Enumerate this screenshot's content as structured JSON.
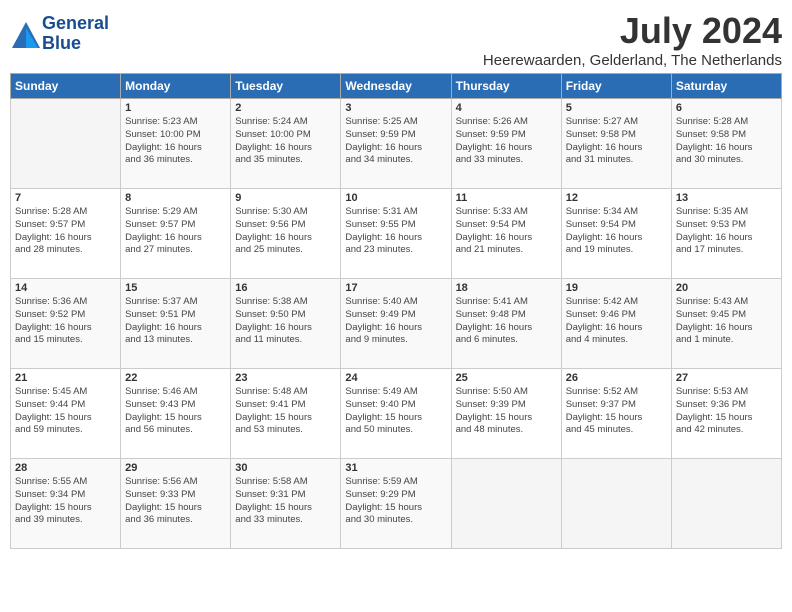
{
  "header": {
    "logo_line1": "General",
    "logo_line2": "Blue",
    "month": "July 2024",
    "location": "Heerewaarden, Gelderland, The Netherlands"
  },
  "days_of_week": [
    "Sunday",
    "Monday",
    "Tuesday",
    "Wednesday",
    "Thursday",
    "Friday",
    "Saturday"
  ],
  "weeks": [
    [
      {
        "num": "",
        "info": ""
      },
      {
        "num": "1",
        "info": "Sunrise: 5:23 AM\nSunset: 10:00 PM\nDaylight: 16 hours\nand 36 minutes."
      },
      {
        "num": "2",
        "info": "Sunrise: 5:24 AM\nSunset: 10:00 PM\nDaylight: 16 hours\nand 35 minutes."
      },
      {
        "num": "3",
        "info": "Sunrise: 5:25 AM\nSunset: 9:59 PM\nDaylight: 16 hours\nand 34 minutes."
      },
      {
        "num": "4",
        "info": "Sunrise: 5:26 AM\nSunset: 9:59 PM\nDaylight: 16 hours\nand 33 minutes."
      },
      {
        "num": "5",
        "info": "Sunrise: 5:27 AM\nSunset: 9:58 PM\nDaylight: 16 hours\nand 31 minutes."
      },
      {
        "num": "6",
        "info": "Sunrise: 5:28 AM\nSunset: 9:58 PM\nDaylight: 16 hours\nand 30 minutes."
      }
    ],
    [
      {
        "num": "7",
        "info": "Sunrise: 5:28 AM\nSunset: 9:57 PM\nDaylight: 16 hours\nand 28 minutes."
      },
      {
        "num": "8",
        "info": "Sunrise: 5:29 AM\nSunset: 9:57 PM\nDaylight: 16 hours\nand 27 minutes."
      },
      {
        "num": "9",
        "info": "Sunrise: 5:30 AM\nSunset: 9:56 PM\nDaylight: 16 hours\nand 25 minutes."
      },
      {
        "num": "10",
        "info": "Sunrise: 5:31 AM\nSunset: 9:55 PM\nDaylight: 16 hours\nand 23 minutes."
      },
      {
        "num": "11",
        "info": "Sunrise: 5:33 AM\nSunset: 9:54 PM\nDaylight: 16 hours\nand 21 minutes."
      },
      {
        "num": "12",
        "info": "Sunrise: 5:34 AM\nSunset: 9:54 PM\nDaylight: 16 hours\nand 19 minutes."
      },
      {
        "num": "13",
        "info": "Sunrise: 5:35 AM\nSunset: 9:53 PM\nDaylight: 16 hours\nand 17 minutes."
      }
    ],
    [
      {
        "num": "14",
        "info": "Sunrise: 5:36 AM\nSunset: 9:52 PM\nDaylight: 16 hours\nand 15 minutes."
      },
      {
        "num": "15",
        "info": "Sunrise: 5:37 AM\nSunset: 9:51 PM\nDaylight: 16 hours\nand 13 minutes."
      },
      {
        "num": "16",
        "info": "Sunrise: 5:38 AM\nSunset: 9:50 PM\nDaylight: 16 hours\nand 11 minutes."
      },
      {
        "num": "17",
        "info": "Sunrise: 5:40 AM\nSunset: 9:49 PM\nDaylight: 16 hours\nand 9 minutes."
      },
      {
        "num": "18",
        "info": "Sunrise: 5:41 AM\nSunset: 9:48 PM\nDaylight: 16 hours\nand 6 minutes."
      },
      {
        "num": "19",
        "info": "Sunrise: 5:42 AM\nSunset: 9:46 PM\nDaylight: 16 hours\nand 4 minutes."
      },
      {
        "num": "20",
        "info": "Sunrise: 5:43 AM\nSunset: 9:45 PM\nDaylight: 16 hours\nand 1 minute."
      }
    ],
    [
      {
        "num": "21",
        "info": "Sunrise: 5:45 AM\nSunset: 9:44 PM\nDaylight: 15 hours\nand 59 minutes."
      },
      {
        "num": "22",
        "info": "Sunrise: 5:46 AM\nSunset: 9:43 PM\nDaylight: 15 hours\nand 56 minutes."
      },
      {
        "num": "23",
        "info": "Sunrise: 5:48 AM\nSunset: 9:41 PM\nDaylight: 15 hours\nand 53 minutes."
      },
      {
        "num": "24",
        "info": "Sunrise: 5:49 AM\nSunset: 9:40 PM\nDaylight: 15 hours\nand 50 minutes."
      },
      {
        "num": "25",
        "info": "Sunrise: 5:50 AM\nSunset: 9:39 PM\nDaylight: 15 hours\nand 48 minutes."
      },
      {
        "num": "26",
        "info": "Sunrise: 5:52 AM\nSunset: 9:37 PM\nDaylight: 15 hours\nand 45 minutes."
      },
      {
        "num": "27",
        "info": "Sunrise: 5:53 AM\nSunset: 9:36 PM\nDaylight: 15 hours\nand 42 minutes."
      }
    ],
    [
      {
        "num": "28",
        "info": "Sunrise: 5:55 AM\nSunset: 9:34 PM\nDaylight: 15 hours\nand 39 minutes."
      },
      {
        "num": "29",
        "info": "Sunrise: 5:56 AM\nSunset: 9:33 PM\nDaylight: 15 hours\nand 36 minutes."
      },
      {
        "num": "30",
        "info": "Sunrise: 5:58 AM\nSunset: 9:31 PM\nDaylight: 15 hours\nand 33 minutes."
      },
      {
        "num": "31",
        "info": "Sunrise: 5:59 AM\nSunset: 9:29 PM\nDaylight: 15 hours\nand 30 minutes."
      },
      {
        "num": "",
        "info": ""
      },
      {
        "num": "",
        "info": ""
      },
      {
        "num": "",
        "info": ""
      }
    ]
  ]
}
